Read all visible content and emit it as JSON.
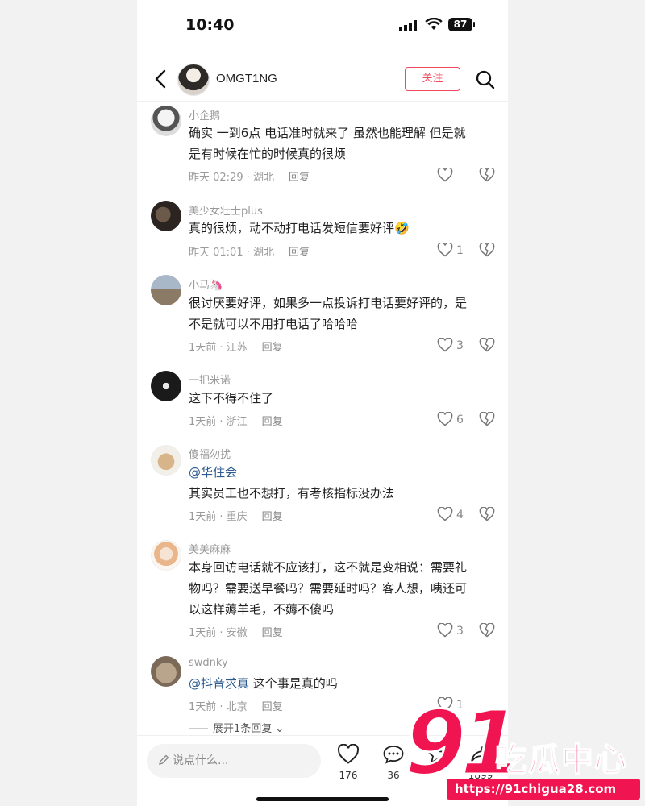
{
  "status": {
    "time": "10:40",
    "battery": "87"
  },
  "header": {
    "username": "OMGT1NG",
    "follow_label": "关注"
  },
  "comments": [
    {
      "name": "小企鹅",
      "lines": [
        "确实 一到6点 电话准时就来了 虽然也能理解 但是就",
        "是有时候在忙的时候真的很烦"
      ],
      "meta": "昨天 02:29 · 湖北",
      "reply": "回复",
      "likes": ""
    },
    {
      "name": "美少女壮士plus",
      "lines": [
        "真的很烦，动不动打电话发短信要好评🤣"
      ],
      "meta": "昨天 01:01 · 湖北",
      "reply": "回复",
      "likes": "1"
    },
    {
      "name": "小马🦄",
      "lines": [
        "很讨厌要好评，如果多一点投诉打电话要好评的，是",
        "不是就可以不用打电话了哈哈哈"
      ],
      "meta": "1天前 · 江苏",
      "reply": "回复",
      "likes": "3"
    },
    {
      "name": "一把米诺",
      "lines": [
        "这下不得不住了"
      ],
      "meta": "1天前 · 浙江",
      "reply": "回复",
      "likes": "6"
    },
    {
      "name": "傻福勿扰",
      "mention": "@华住会",
      "lines": [
        "其实员工也不想打，有考核指标没办法"
      ],
      "meta": "1天前 · 重庆",
      "reply": "回复",
      "likes": "4"
    },
    {
      "name": "美美麻麻",
      "lines": [
        "本身回访电话就不应该打，这不就是变相说：需要礼",
        "物吗？需要送早餐吗？需要延时吗？客人想，咦还可",
        "以这样薅羊毛，不薅不傻吗"
      ],
      "meta": "1天前 · 安徽",
      "reply": "回复",
      "likes": "3"
    },
    {
      "name": "swdnky",
      "mention": "@抖音求真",
      "lines": [
        "这个事是真的吗"
      ],
      "meta": "1天前 · 北京",
      "reply": "回复",
      "likes": "1"
    }
  ],
  "expand_label": "展开1条回复",
  "bottom": {
    "input_placeholder": "说点什么...",
    "likes": "176",
    "comments": "36",
    "shares": "1899"
  },
  "watermark": {
    "number": "91",
    "name": "吃瓜中心",
    "url": "https://91chigua28.com"
  },
  "colors": {
    "accent": "#f2475d",
    "mention": "#2c5a8f",
    "watermark": "#f01550"
  }
}
